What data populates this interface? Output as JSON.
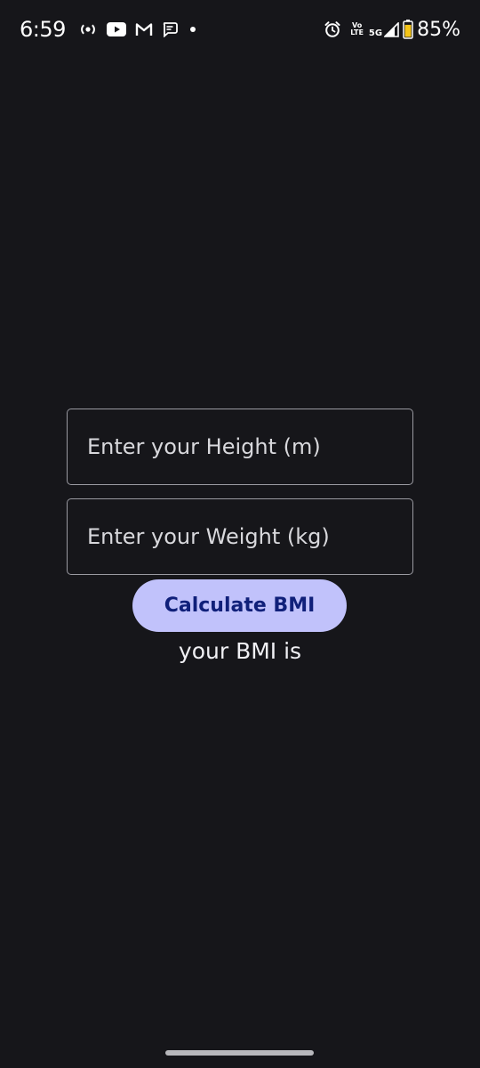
{
  "status_bar": {
    "time": "6:59",
    "left_icons": [
      "hotspot-icon",
      "youtube-icon",
      "gmail-icon",
      "messages-icon",
      "notification-dot-icon"
    ],
    "volte_top": "Vo",
    "volte_bottom": "LTE",
    "network": "5G",
    "battery_percent": "85%",
    "battery_level": 0.85,
    "battery_color": "#f5c518"
  },
  "form": {
    "height_placeholder": "Enter your Height (m)",
    "weight_placeholder": "Enter your Weight (kg)",
    "calculate_label": "Calculate BMI",
    "result_text": "your BMI is"
  },
  "colors": {
    "background": "#16161a",
    "button_bg": "#c1c2fb",
    "button_text": "#10207a",
    "field_border": "#9a9aa1"
  }
}
